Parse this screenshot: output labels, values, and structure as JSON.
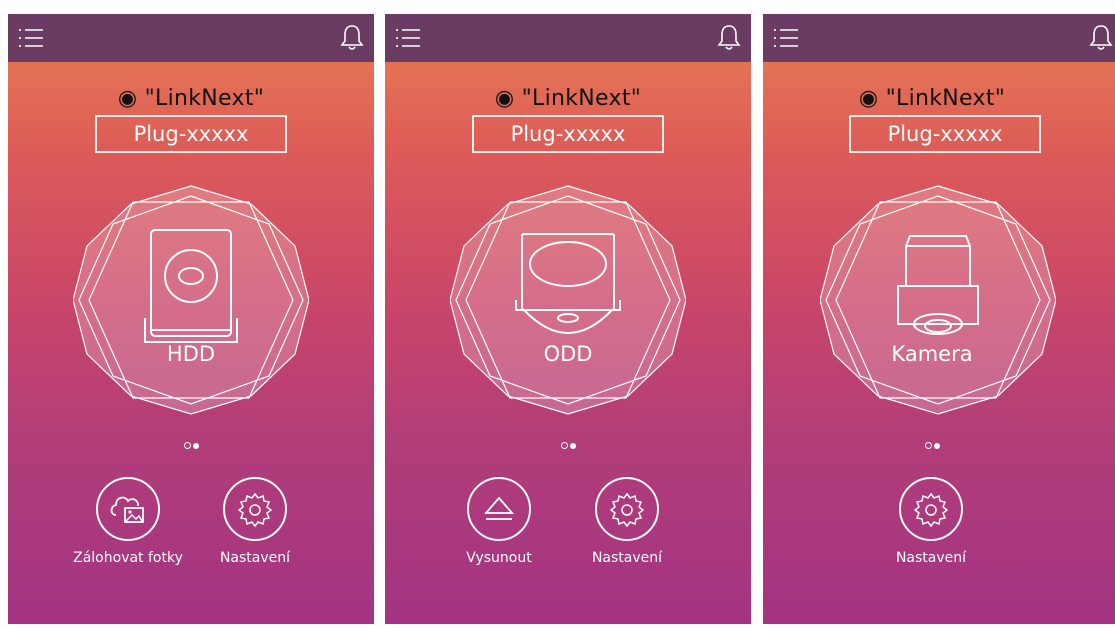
{
  "screens": [
    {
      "device_name": "◉ \"LinkNext\"",
      "plug_id": "Plug-xxxxx",
      "device_label": "HDD",
      "actions": [
        {
          "label": "Zálohovat fotky",
          "icon": "photo-backup-icon"
        },
        {
          "label": "Nastavení",
          "icon": "gear-icon"
        }
      ]
    },
    {
      "device_name": "◉ \"LinkNext\"",
      "plug_id": "Plug-xxxxx",
      "device_label": "ODD",
      "actions": [
        {
          "label": "Vysunout",
          "icon": "eject-icon"
        },
        {
          "label": "Nastavení",
          "icon": "gear-icon"
        }
      ]
    },
    {
      "device_name": "◉ \"LinkNext\"",
      "plug_id": "Plug-xxxxx",
      "device_label": "Kamera",
      "actions": [
        {
          "label": "Nastavení",
          "icon": "gear-icon"
        }
      ]
    }
  ],
  "pager": {
    "total": 2,
    "active": 2
  },
  "colors": {
    "topbar": "#6b3c63",
    "gradient_top": "#e77f52",
    "gradient_bottom": "#a33483",
    "foreground": "#ffffff"
  }
}
